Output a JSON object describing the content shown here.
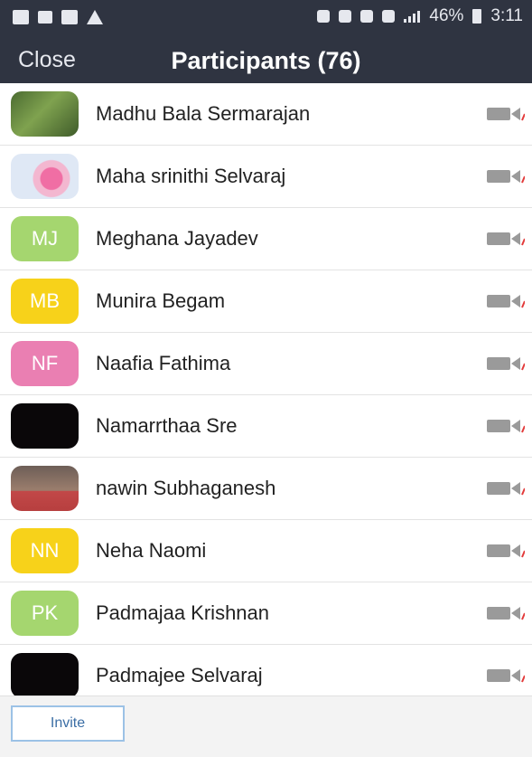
{
  "status_bar": {
    "battery_percent": "46%",
    "time": "3:11"
  },
  "header": {
    "close_label": "Close",
    "title": "Participants (76)"
  },
  "participants": [
    {
      "name": "Madhu Bala Sermarajan",
      "avatar_type": "photo",
      "avatar_style": "leaf",
      "initials": ""
    },
    {
      "name": "Maha srinithi Selvaraj",
      "avatar_type": "photo",
      "avatar_style": "flower",
      "initials": ""
    },
    {
      "name": "Meghana Jayadev",
      "avatar_type": "initials",
      "initials": "MJ",
      "color": "#a5d66f"
    },
    {
      "name": "Munira Begam",
      "avatar_type": "initials",
      "initials": "MB",
      "color": "#f7d21a"
    },
    {
      "name": "Naafia Fathima",
      "avatar_type": "initials",
      "initials": "NF",
      "color": "#ea7fb2"
    },
    {
      "name": "Namarrthaa Sre",
      "avatar_type": "photo",
      "avatar_style": "dark",
      "initials": ""
    },
    {
      "name": "nawin Subhaganesh",
      "avatar_type": "photo",
      "avatar_style": "man",
      "initials": ""
    },
    {
      "name": "Neha Naomi",
      "avatar_type": "initials",
      "initials": "NN",
      "color": "#f7d21a"
    },
    {
      "name": "Padmajaa Krishnan",
      "avatar_type": "initials",
      "initials": "PK",
      "color": "#a5d66f"
    },
    {
      "name": "Padmajee Selvaraj",
      "avatar_type": "photo",
      "avatar_style": "dark",
      "initials": ""
    }
  ],
  "footer": {
    "invite_label": "Invite"
  },
  "colors": {
    "header_bg": "#2f3441",
    "muted_icon": "#9a9a9a",
    "muted_slash": "#e33b3b"
  }
}
